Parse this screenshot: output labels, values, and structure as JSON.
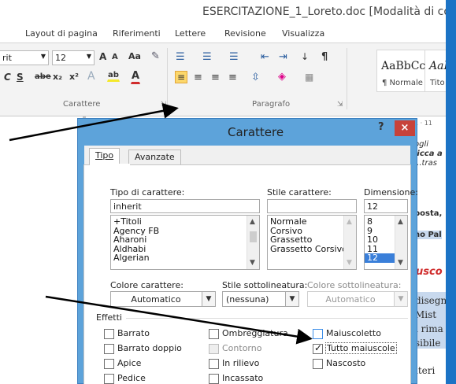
{
  "window": {
    "title": "ESERCITAZIONE_1_Loreto.doc [Modalità di compa"
  },
  "ribbon_tabs": [
    "Layout di pagina",
    "Riferimenti",
    "Lettere",
    "Revisione",
    "Visualizza"
  ],
  "font_group": {
    "font_name_partial": "rit",
    "font_size": "12",
    "grow": "A",
    "shrink": "A",
    "change_case": "Aa",
    "italic": "C",
    "underline": "S",
    "strike": "abe",
    "subscript": "x₂",
    "superscript": "x²",
    "text_effects": "A",
    "highlight": "ab",
    "font_color": "A",
    "label": "Carattere"
  },
  "paragraph_group": {
    "label": "Paragrafo"
  },
  "styles": [
    {
      "preview": "AaBbCcI",
      "name": "¶ Normale"
    },
    {
      "preview": "AaB",
      "name": "Tito"
    }
  ],
  "colors": {
    "accent": "#1c73c5",
    "dialog_frame": "#5da3da",
    "close": "#c7423a",
    "arrow": "#000000"
  },
  "dialog": {
    "title": "Carattere",
    "help": "?",
    "close": "×",
    "tabs": [
      "Tipo",
      "Avanzate"
    ],
    "font_label": "Tipo di carattere:",
    "font_value": "inherit",
    "font_list": [
      "+Titoli",
      "Agency FB",
      "Aharoni",
      "Aldhabi",
      "Algerian"
    ],
    "style_label": "Stile carattere:",
    "style_value": "",
    "style_list": [
      "Normale",
      "Corsivo",
      "Grassetto",
      "Grassetto Corsivo"
    ],
    "size_label": "Dimensione:",
    "size_value": "12",
    "size_list": [
      "8",
      "9",
      "10",
      "11",
      "12"
    ],
    "color_label": "Colore carattere:",
    "color_value": "Automatico",
    "underline_label": "Stile sottolineatura:",
    "underline_value": "(nessuna)",
    "underline_color_label": "Colore sottolineatura:",
    "underline_color_value": "Automatico",
    "effects_label": "Effetti",
    "effects": {
      "barrato": "Barrato",
      "barrato_doppio": "Barrato doppio",
      "apice": "Apice",
      "pedice": "Pedice",
      "ombreggiatura": "Ombreggiatura",
      "contorno": "Contorno",
      "rilievo": "In rilievo",
      "incassato": "Incassato",
      "maiuscoletto": "Maiuscoletto",
      "tutto_maiuscole": "Tutto maiuscole",
      "nascosto": "Nascosto"
    }
  },
  "doc_right": [
    "1 · 11",
    "ogli",
    "licca a",
    "...tras",
    "posta,",
    "no Pal",
    "usco",
    "disegn",
    "Mist",
    "i rima",
    "sibile",
    "iteri"
  ]
}
